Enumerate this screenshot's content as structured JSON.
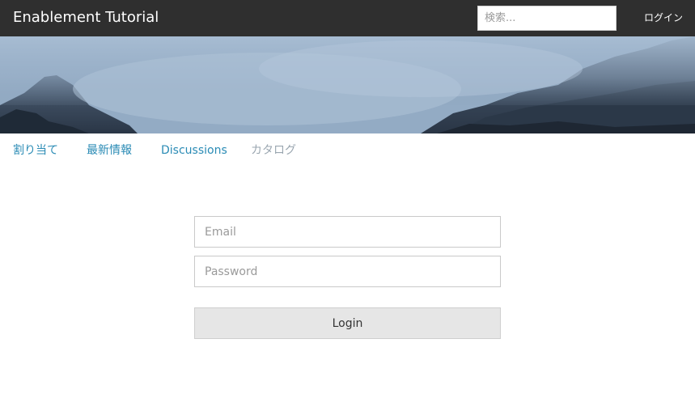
{
  "header": {
    "title": "Enablement Tutorial",
    "search_placeholder": "検索...",
    "login_label": "ログイン"
  },
  "nav": {
    "items": [
      {
        "label": "割り当て"
      },
      {
        "label": "最新情報"
      },
      {
        "label": "Discussions"
      },
      {
        "label": "カタログ"
      }
    ]
  },
  "login_form": {
    "email_placeholder": "Email",
    "password_placeholder": "Password",
    "submit_label": "Login"
  },
  "colors": {
    "topbar": "#2f2f2f",
    "link": "#2a8bb5",
    "muted_link": "#9aa6b0",
    "button_bg": "#e6e6e6"
  }
}
